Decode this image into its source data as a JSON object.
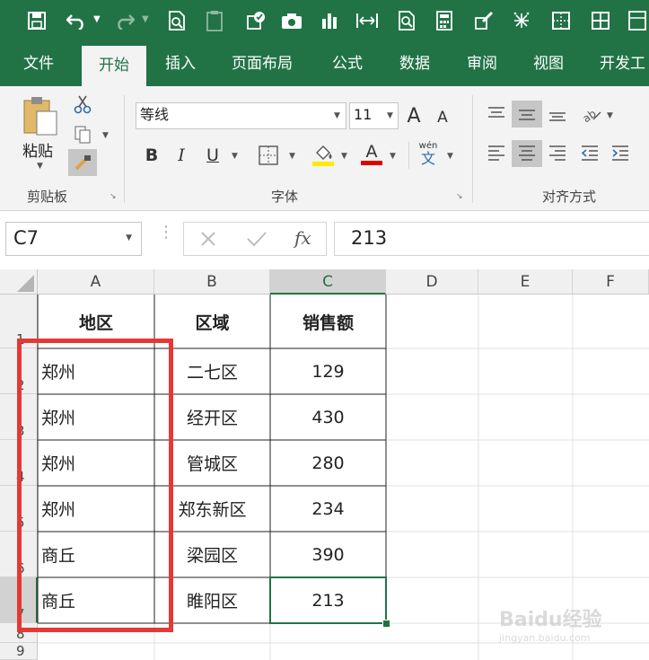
{
  "quick_access": {
    "icons": [
      "save-icon",
      "undo-icon",
      "redo-icon",
      "print-preview-icon",
      "clipboard-icon",
      "pen-icon",
      "camera-icon",
      "chart-icon",
      "column-width-icon",
      "find-icon",
      "calculator-icon",
      "brush-icon",
      "asterisk-icon",
      "border-icon",
      "grid-icon"
    ]
  },
  "tabs": [
    "文件",
    "开始",
    "插入",
    "页面布局",
    "公式",
    "数据",
    "审阅",
    "视图",
    "开发工"
  ],
  "clipboard": {
    "paste_label": "粘贴",
    "group_label": "剪贴板"
  },
  "font": {
    "name": "等线",
    "size": "11",
    "group_label": "字体",
    "bold": "B",
    "italic": "I",
    "underline": "U",
    "font_color_glyph": "A",
    "phonetic_top": "wén",
    "phonetic_bottom": "文",
    "grow_glyph": "A",
    "shrink_glyph": "A"
  },
  "alignment": {
    "group_label": "对齐方式"
  },
  "formula_bar": {
    "name_box": "C7",
    "fx": "fx",
    "value": "213"
  },
  "columns": [
    "A",
    "B",
    "C",
    "D",
    "E",
    "F"
  ],
  "rows": [
    "1",
    "2",
    "3",
    "4",
    "5",
    "6",
    "7",
    "8",
    "9"
  ],
  "table": {
    "headers": [
      "地区",
      "区域",
      "销售额"
    ],
    "rows": [
      [
        "郑州",
        "二七区",
        "129"
      ],
      [
        "郑州",
        "经开区",
        "430"
      ],
      [
        "郑州",
        "管城区",
        "280"
      ],
      [
        "郑州",
        "郑东新区",
        "234"
      ],
      [
        "商丘",
        "梁园区",
        "390"
      ],
      [
        "商丘",
        "睢阳区",
        "213"
      ]
    ]
  },
  "colors": {
    "excel_green": "#217346",
    "highlight_red": "#e53935",
    "font_yellow": "#ffeb00",
    "font_red": "#e00000"
  },
  "watermark": {
    "brand": "Baidu经验",
    "url": "jingyan.baidu.com"
  }
}
